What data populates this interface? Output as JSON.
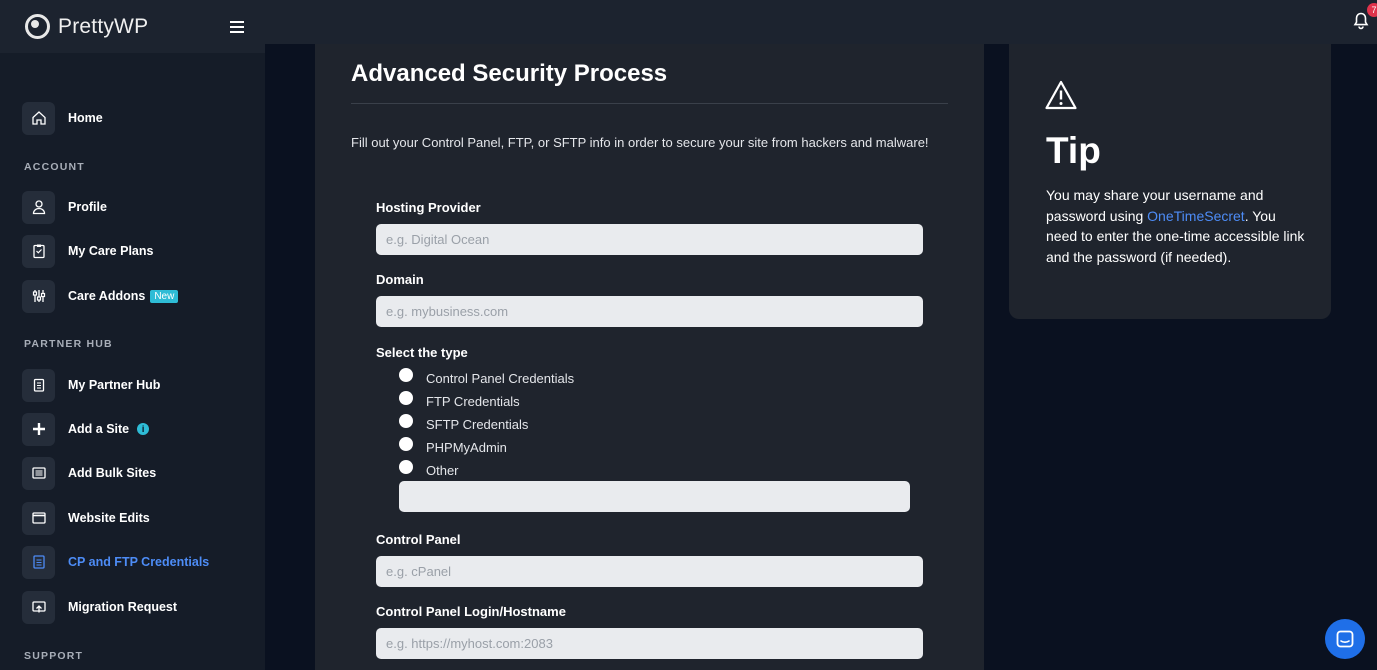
{
  "brand": {
    "name": "PrettyWP"
  },
  "header": {
    "notification_count": "7"
  },
  "sidebar": {
    "home": "Home",
    "section_account": "ACCOUNT",
    "profile": "Profile",
    "care_plans": "My Care Plans",
    "care_addons": "Care Addons",
    "care_addons_badge": "New",
    "section_partner": "PARTNER HUB",
    "partner_hub": "My Partner Hub",
    "add_site": "Add a Site",
    "add_site_info": "i",
    "add_bulk": "Add Bulk Sites",
    "website_edits": "Website Edits",
    "credentials": "CP and FTP Credentials",
    "migration": "Migration Request",
    "section_support": "SUPPORT"
  },
  "form": {
    "title": "Advanced Security Process",
    "description": "Fill out your Control Panel, FTP, or SFTP info in order to secure your site from hackers and malware!",
    "hosting_label": "Hosting Provider",
    "hosting_placeholder": "e.g. Digital Ocean",
    "domain_label": "Domain",
    "domain_placeholder": "e.g. mybusiness.com",
    "type_label": "Select the type",
    "types": [
      "Control Panel Credentials",
      "FTP Credentials",
      "SFTP Credentials",
      "PHPMyAdmin",
      "Other"
    ],
    "other_value": "",
    "cp_label": "Control Panel",
    "cp_placeholder": "e.g. cPanel",
    "login_label": "Control Panel Login/Hostname",
    "login_placeholder": "e.g. https://myhost.com:2083"
  },
  "tip": {
    "title": "Tip",
    "text_before": "You may share your username and password using ",
    "link": "OneTimeSecret",
    "text_after": ". You need to enter the one-time accessible link and the password (if needed)."
  },
  "colors": {
    "accent": "#4d8cf6",
    "badge": "#2ebcd6",
    "chat": "#1f6fe8"
  }
}
